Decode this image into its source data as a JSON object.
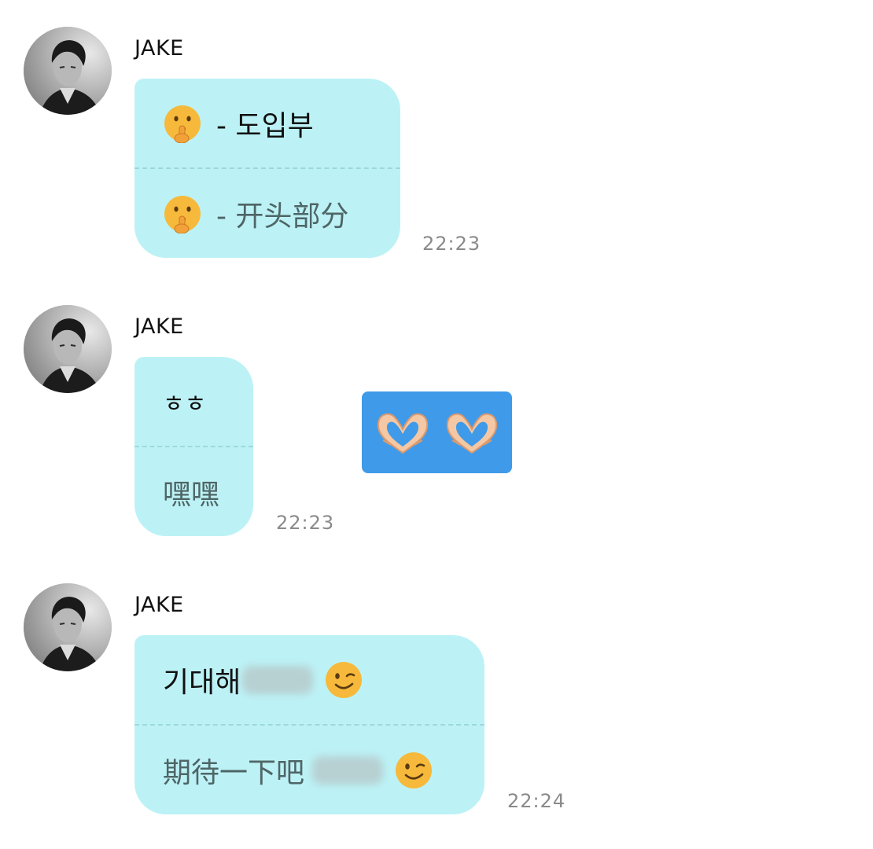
{
  "messages": [
    {
      "sender": "JAKE",
      "original": "- 도입부",
      "translation": "- 开头部分",
      "icon": "shushing-face-icon",
      "time": "22:23"
    },
    {
      "sender": "JAKE",
      "original": "ㅎㅎ",
      "translation": "嘿嘿",
      "time": "22:23",
      "sticker_icons": [
        "heart-hands-icon",
        "heart-hands-icon"
      ],
      "sticker_color": "#3f9ae9"
    },
    {
      "sender": "JAKE",
      "original": "기대해",
      "translation": "期待一下吧",
      "icon": "winking-face-icon",
      "time": "22:24"
    }
  ],
  "colors": {
    "bubble": "#bcf2f6",
    "timestamp": "#8a8a8a",
    "translation_text": "#4f6566"
  }
}
